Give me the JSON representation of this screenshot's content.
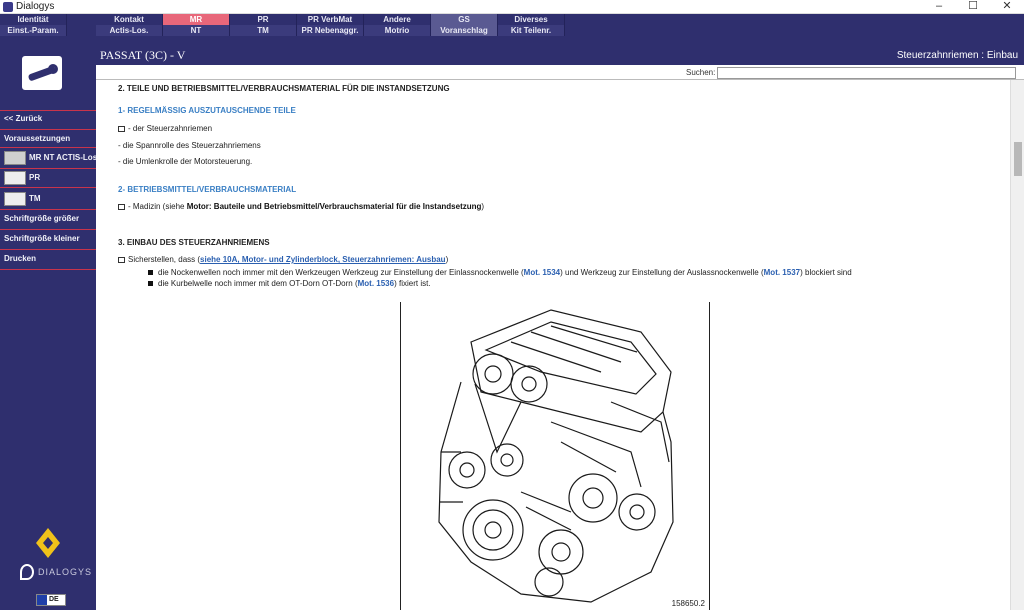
{
  "window": {
    "title": "Dialogys",
    "min": "–",
    "max": "☐",
    "close": "✕"
  },
  "menu": [
    {
      "top": "Identität",
      "bottom": "Einst.-Param."
    },
    {
      "top": "Kontakt",
      "bottom": "Actis-Los."
    },
    {
      "top": "MR",
      "bottom": "NT"
    },
    {
      "top": "PR",
      "bottom": "TM"
    },
    {
      "top": "PR VerbMat",
      "bottom": "PR Nebenaggr."
    },
    {
      "top": "Andere",
      "bottom": "Motrio"
    },
    {
      "top": "GS",
      "bottom": "Voranschlag"
    },
    {
      "top": "Diverses",
      "bottom": "Kit Teilenr."
    }
  ],
  "sidebar": {
    "back": "<< Zurück",
    "prerequisites": "Voraussetzungen",
    "mr_actis": "MR NT ACTIS-Los.",
    "pr": "PR",
    "tm": "TM",
    "font_bigger": "Schriftgröße größer",
    "font_smaller": "Schriftgröße kleiner",
    "print": "Drucken",
    "brand": "DIALOGYS",
    "flag_text": "DE"
  },
  "header": {
    "vehicle": "PASSAT (3C) - V",
    "section": "Steuerzahnriemen : Einbau"
  },
  "search": {
    "label": "Suchen:",
    "value": ""
  },
  "doc": {
    "h2": "2. TEILE UND BETRIEBSMITTEL/VERBRAUCHSMATERIAL FÜR DIE INSTANDSETZUNG",
    "sub1": "1- REGELMÄSSIG AUSZUTAUSCHENDE TEILE",
    "item1": "- der Steuerzahnriemen",
    "item2": "- die Spannrolle des Steuerzahnriemens",
    "item3": "- die Umlenkrolle der Motorsteuerung.",
    "sub2": "2- BETRIEBSMITTEL/VERBRAUCHSMATERIAL",
    "item4_pre": "- Madizin (siehe ",
    "item4_bold": "Motor: Bauteile und Betriebsmittel/Verbrauchsmaterial für die Instandsetzung",
    "item4_post": ")",
    "h3": "3. EINBAU DES STEUERZAHNRIEMENS",
    "check_pre": "Sicherstellen, dass (",
    "check_link": "siehe 10A, Motor- und Zylinderblock, Steuerzahnriemen: Ausbau",
    "check_post": ")",
    "b1_pre": "die Nockenwellen noch immer mit den Werkzeugen Werkzeug zur Einstellung der Einlassnockenwelle (",
    "b1_ref1": "Mot. 1534",
    "b1_mid": ") und Werkzeug zur Einstellung der Auslassnockenwelle (",
    "b1_ref2": "Mot. 1537",
    "b1_post": ") blockiert sind",
    "b2_pre": "die Kurbelwelle noch immer mit dem OT-Dorn OT-Dorn (",
    "b2_ref": "Mot. 1536",
    "b2_post": ") fixiert ist.",
    "figure_caption": "158650.2"
  }
}
